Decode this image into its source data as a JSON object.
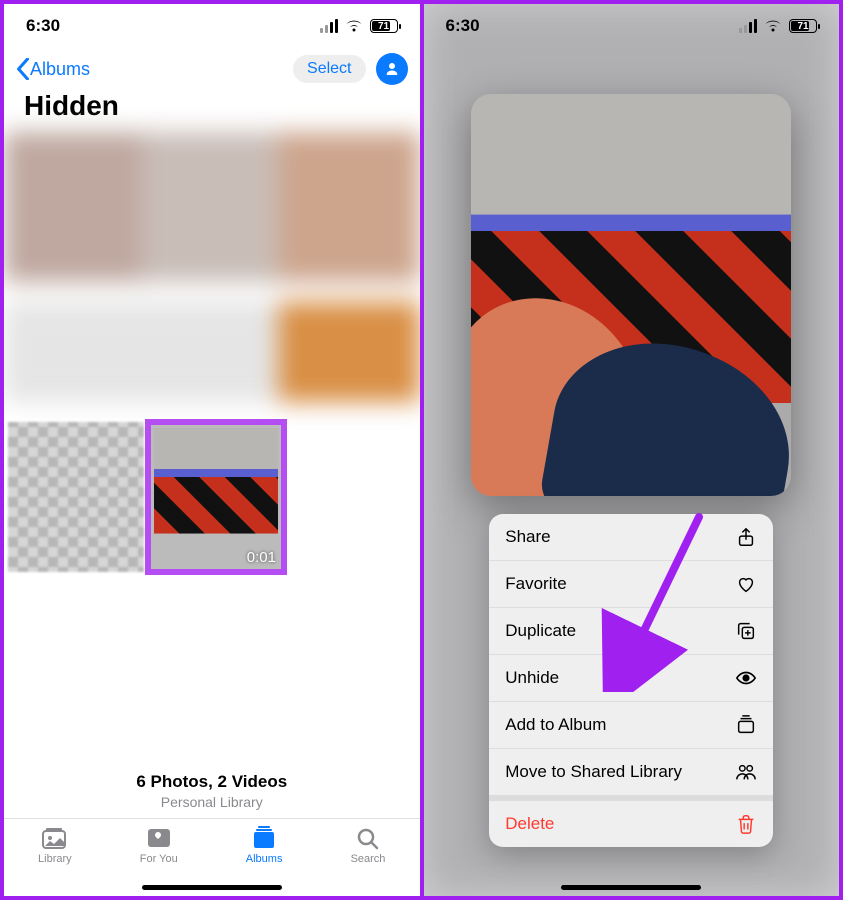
{
  "status": {
    "time": "6:30",
    "battery": "71"
  },
  "left": {
    "back_label": "Albums",
    "select_label": "Select",
    "title": "Hidden",
    "video_duration": "0:01",
    "summary_line1": "6 Photos, 2 Videos",
    "summary_line2": "Personal Library",
    "tabs": {
      "library": "Library",
      "foryou": "For You",
      "albums": "Albums",
      "search": "Search"
    }
  },
  "right": {
    "menu": {
      "share": "Share",
      "favorite": "Favorite",
      "duplicate": "Duplicate",
      "unhide": "Unhide",
      "add_to_album": "Add to Album",
      "move_to_shared": "Move to Shared Library",
      "delete": "Delete"
    }
  }
}
